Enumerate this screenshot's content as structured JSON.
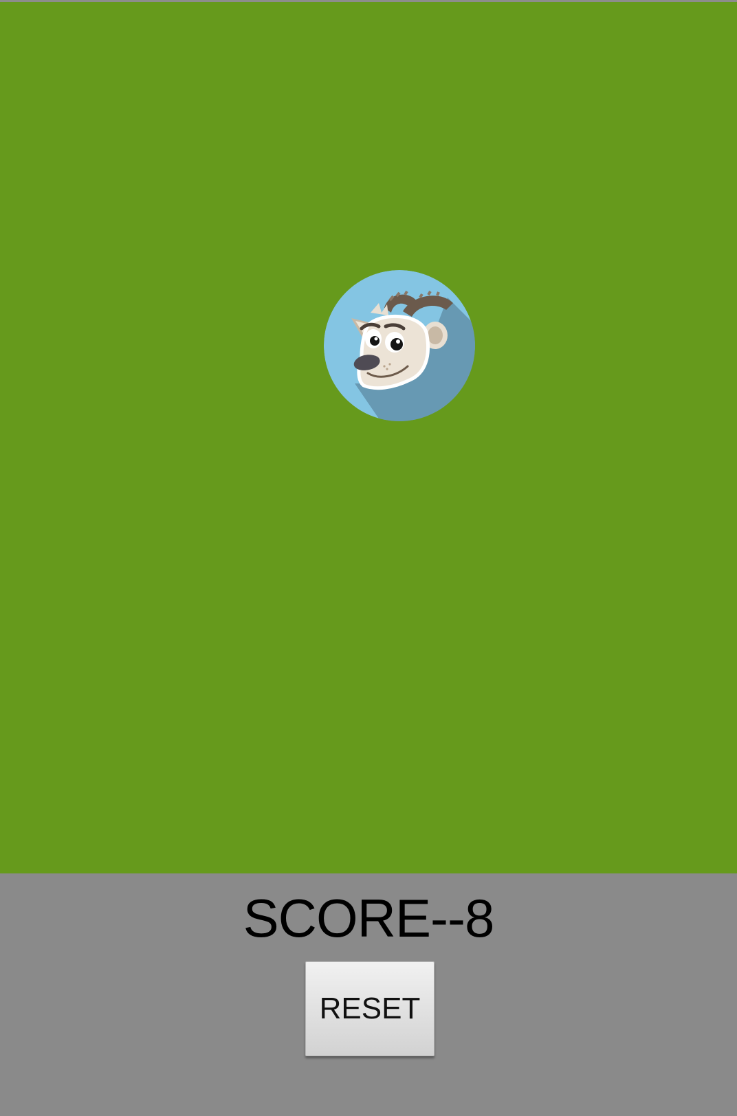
{
  "game": {
    "score_text": "SCORE--8",
    "reset_label": "RESET",
    "target_character": "goat-icon"
  },
  "colors": {
    "field": "#669a1c",
    "panel": "#8a8a8a",
    "target_background": "#84c5e3"
  }
}
